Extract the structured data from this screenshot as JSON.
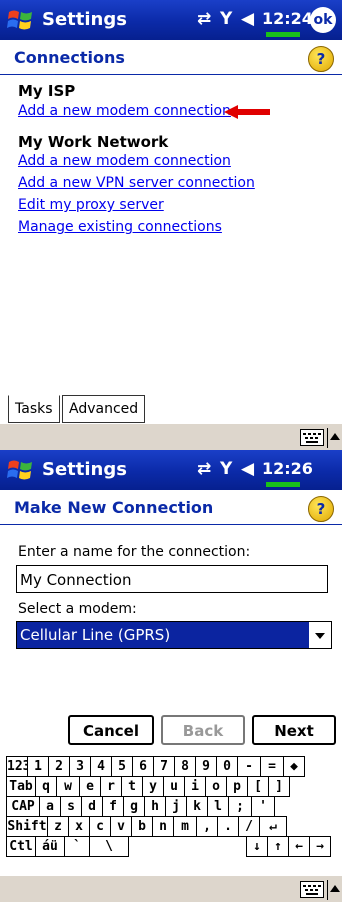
{
  "screen1": {
    "title_bar": {
      "app_title": "Settings",
      "status_icons": [
        "connectivity-icon",
        "signal-off-icon",
        "volume-icon"
      ],
      "time": "12:24",
      "ok_label": "ok"
    },
    "header": {
      "title": "Connections",
      "help_icon": "help-icon"
    },
    "sections": [
      {
        "heading": "My ISP",
        "links": [
          "Add a new modem connection"
        ]
      },
      {
        "heading": "My Work Network",
        "links": [
          "Add a new modem connection",
          "Add a new VPN server connection",
          "Edit my proxy server",
          "Manage existing connections"
        ]
      }
    ],
    "annotation": "red-arrow-pointer",
    "tabs": [
      "Tasks",
      "Advanced"
    ],
    "sip": [
      "keyboard-icon",
      "sip-up-arrow-icon"
    ]
  },
  "screen2": {
    "title_bar": {
      "app_title": "Settings",
      "status_icons": [
        "connectivity-icon",
        "signal-off-icon",
        "volume-icon"
      ],
      "time": "12:26"
    },
    "header": {
      "title": "Make New Connection",
      "help_icon": "help-icon"
    },
    "name_label": "Enter a name for the connection:",
    "name_value": "My Connection",
    "modem_label": "Select a modem:",
    "modem_selected": "Cellular Line (GPRS)",
    "buttons": {
      "cancel": "Cancel",
      "back": "Back",
      "next": "Next"
    },
    "keyboard": {
      "row1": [
        "123",
        "1",
        "2",
        "3",
        "4",
        "5",
        "6",
        "7",
        "8",
        "9",
        "0",
        "-",
        "=",
        "◆"
      ],
      "row2": [
        "Tab",
        "q",
        "w",
        "e",
        "r",
        "t",
        "y",
        "u",
        "i",
        "o",
        "p",
        "[",
        "]"
      ],
      "row3": [
        "CAP",
        "a",
        "s",
        "d",
        "f",
        "g",
        "h",
        "j",
        "k",
        "l",
        ";",
        "'"
      ],
      "row4": [
        "Shift",
        "z",
        "x",
        "c",
        "v",
        "b",
        "n",
        "m",
        ",",
        ".",
        "/",
        "↵"
      ],
      "row5": [
        "Ctl",
        "áü",
        "`",
        "\\",
        "↓",
        "↑",
        "←",
        "→"
      ]
    }
  },
  "colors": {
    "titlebar": "#0b2aa8",
    "link": "#0000ee",
    "selection": "#0b24a0",
    "command_bar": "#ddd6cc",
    "annotation_arrow": "#e00000"
  }
}
